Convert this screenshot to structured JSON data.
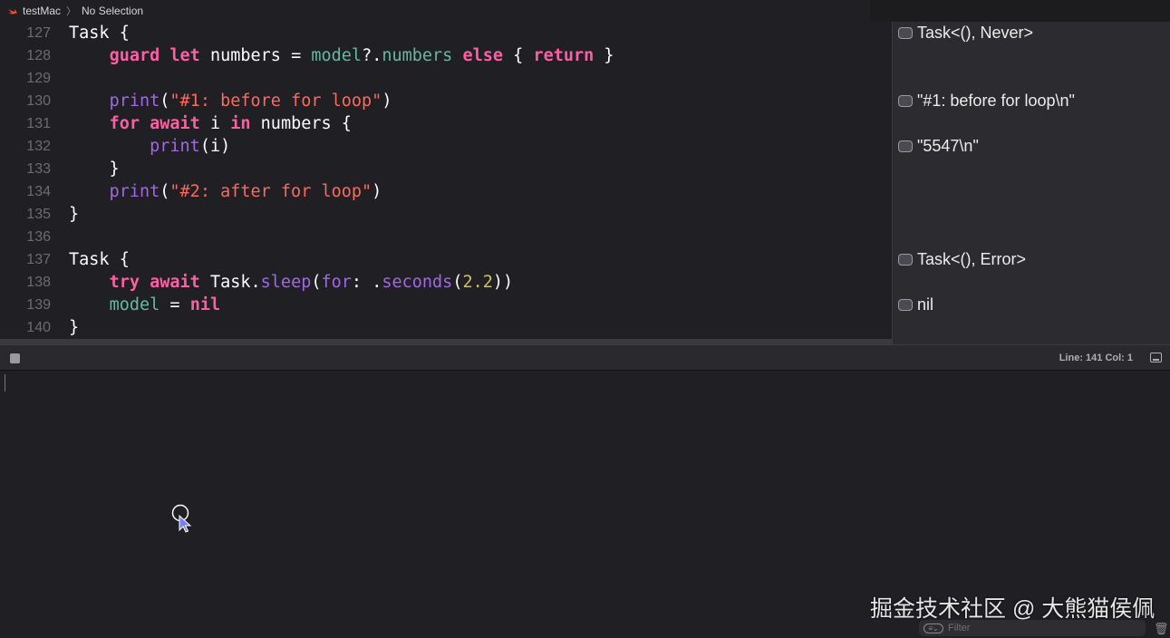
{
  "breadcrumb": {
    "project": "testMac",
    "selection": "No Selection"
  },
  "editor": {
    "lines": [
      {
        "num": "127",
        "tokens": [
          {
            "t": "Task",
            "c": "pl"
          },
          {
            "t": " {",
            "c": "pl"
          }
        ]
      },
      {
        "num": "128",
        "tokens": [
          {
            "t": "    ",
            "c": "pl"
          },
          {
            "t": "guard",
            "c": "kw"
          },
          {
            "t": " ",
            "c": "pl"
          },
          {
            "t": "let",
            "c": "kw"
          },
          {
            "t": " numbers = ",
            "c": "pl"
          },
          {
            "t": "model",
            "c": "prop"
          },
          {
            "t": "?.",
            "c": "pl"
          },
          {
            "t": "numbers",
            "c": "prop"
          },
          {
            "t": " ",
            "c": "pl"
          },
          {
            "t": "else",
            "c": "kw"
          },
          {
            "t": " { ",
            "c": "pl"
          },
          {
            "t": "return",
            "c": "kw"
          },
          {
            "t": " }",
            "c": "pl"
          }
        ]
      },
      {
        "num": "129",
        "tokens": []
      },
      {
        "num": "130",
        "tokens": [
          {
            "t": "    ",
            "c": "pl"
          },
          {
            "t": "print",
            "c": "fn"
          },
          {
            "t": "(",
            "c": "pl"
          },
          {
            "t": "\"#1: before for loop\"",
            "c": "str"
          },
          {
            "t": ")",
            "c": "pl"
          }
        ]
      },
      {
        "num": "131",
        "tokens": [
          {
            "t": "    ",
            "c": "pl"
          },
          {
            "t": "for",
            "c": "kw"
          },
          {
            "t": " ",
            "c": "pl"
          },
          {
            "t": "await",
            "c": "kw"
          },
          {
            "t": " i ",
            "c": "pl"
          },
          {
            "t": "in",
            "c": "kw"
          },
          {
            "t": " numbers {",
            "c": "pl"
          }
        ]
      },
      {
        "num": "132",
        "tokens": [
          {
            "t": "        ",
            "c": "pl"
          },
          {
            "t": "print",
            "c": "fn"
          },
          {
            "t": "(i)",
            "c": "pl"
          }
        ]
      },
      {
        "num": "133",
        "tokens": [
          {
            "t": "    }",
            "c": "pl"
          }
        ]
      },
      {
        "num": "134",
        "tokens": [
          {
            "t": "    ",
            "c": "pl"
          },
          {
            "t": "print",
            "c": "fn"
          },
          {
            "t": "(",
            "c": "pl"
          },
          {
            "t": "\"#2: after for loop\"",
            "c": "str"
          },
          {
            "t": ")",
            "c": "pl"
          }
        ]
      },
      {
        "num": "135",
        "tokens": [
          {
            "t": "}",
            "c": "pl"
          }
        ]
      },
      {
        "num": "136",
        "tokens": []
      },
      {
        "num": "137",
        "tokens": [
          {
            "t": "Task",
            "c": "pl"
          },
          {
            "t": " {",
            "c": "pl"
          }
        ]
      },
      {
        "num": "138",
        "tokens": [
          {
            "t": "    ",
            "c": "pl"
          },
          {
            "t": "try",
            "c": "kw"
          },
          {
            "t": " ",
            "c": "pl"
          },
          {
            "t": "await",
            "c": "kw"
          },
          {
            "t": " Task.",
            "c": "pl"
          },
          {
            "t": "sleep",
            "c": "fn"
          },
          {
            "t": "(",
            "c": "pl"
          },
          {
            "t": "for",
            "c": "fn"
          },
          {
            "t": ": .",
            "c": "pl"
          },
          {
            "t": "seconds",
            "c": "fn"
          },
          {
            "t": "(",
            "c": "pl"
          },
          {
            "t": "2.2",
            "c": "num"
          },
          {
            "t": "))",
            "c": "pl"
          }
        ]
      },
      {
        "num": "139",
        "tokens": [
          {
            "t": "    ",
            "c": "pl"
          },
          {
            "t": "model",
            "c": "prop"
          },
          {
            "t": " = ",
            "c": "pl"
          },
          {
            "t": "nil",
            "c": "kw"
          }
        ]
      },
      {
        "num": "140",
        "tokens": [
          {
            "t": "}",
            "c": "pl"
          }
        ]
      }
    ]
  },
  "results": [
    {
      "line": "127",
      "text": "Task<(), Never>"
    },
    {
      "line": "130",
      "text": "\"#1: before for loop\\n\""
    },
    {
      "line": "132",
      "text": "\"5547\\n\""
    },
    {
      "line": "137",
      "text": "Task<(), Error>"
    },
    {
      "line": "139",
      "text": "nil"
    }
  ],
  "debug": {
    "line_col": "Line: 141  Col: 1"
  },
  "console": {
    "filter_placeholder": "Filter",
    "filter_value": ""
  },
  "watermark": "掘金技术社区 @ 大熊猫侯佩",
  "colors": {
    "keyword": "#fc5fa3",
    "function": "#a167e6",
    "string": "#fc6a5d",
    "property": "#67b7a4",
    "number": "#d0bf69",
    "background": "#1f1f24"
  }
}
